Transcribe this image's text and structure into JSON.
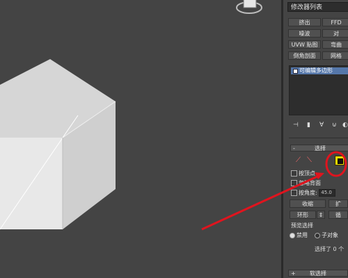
{
  "panel": {
    "modifier_list": "修改器列表",
    "buttons": [
      {
        "label": "挤出"
      },
      {
        "label": "FFD"
      },
      {
        "label": "噪波"
      },
      {
        "label": "对"
      },
      {
        "label": "UVW 贴图"
      },
      {
        "label": "弯曲"
      },
      {
        "label": "倒角剖面"
      },
      {
        "label": "网格"
      }
    ],
    "stack_item": "可编辑多边形",
    "selection_rollout": {
      "title": "选择",
      "by_vertex": "按顶点",
      "ignore_backfacing": "忽略背面",
      "by_angle": "按角度:",
      "angle_value": "45.0",
      "shrink": "收缩",
      "grow": "扩",
      "ring": "环形",
      "loop": "循",
      "preview_title": "预览选择",
      "preview_disabled": "禁用",
      "preview_subobject": "子对象",
      "selected_status": "选择了 0 个"
    },
    "soft_selection_title": "软选择"
  },
  "colors": {
    "annotation_red": "#e0141e",
    "highlight_yellow": "#f2e000",
    "viewport_bg": "#444444"
  }
}
